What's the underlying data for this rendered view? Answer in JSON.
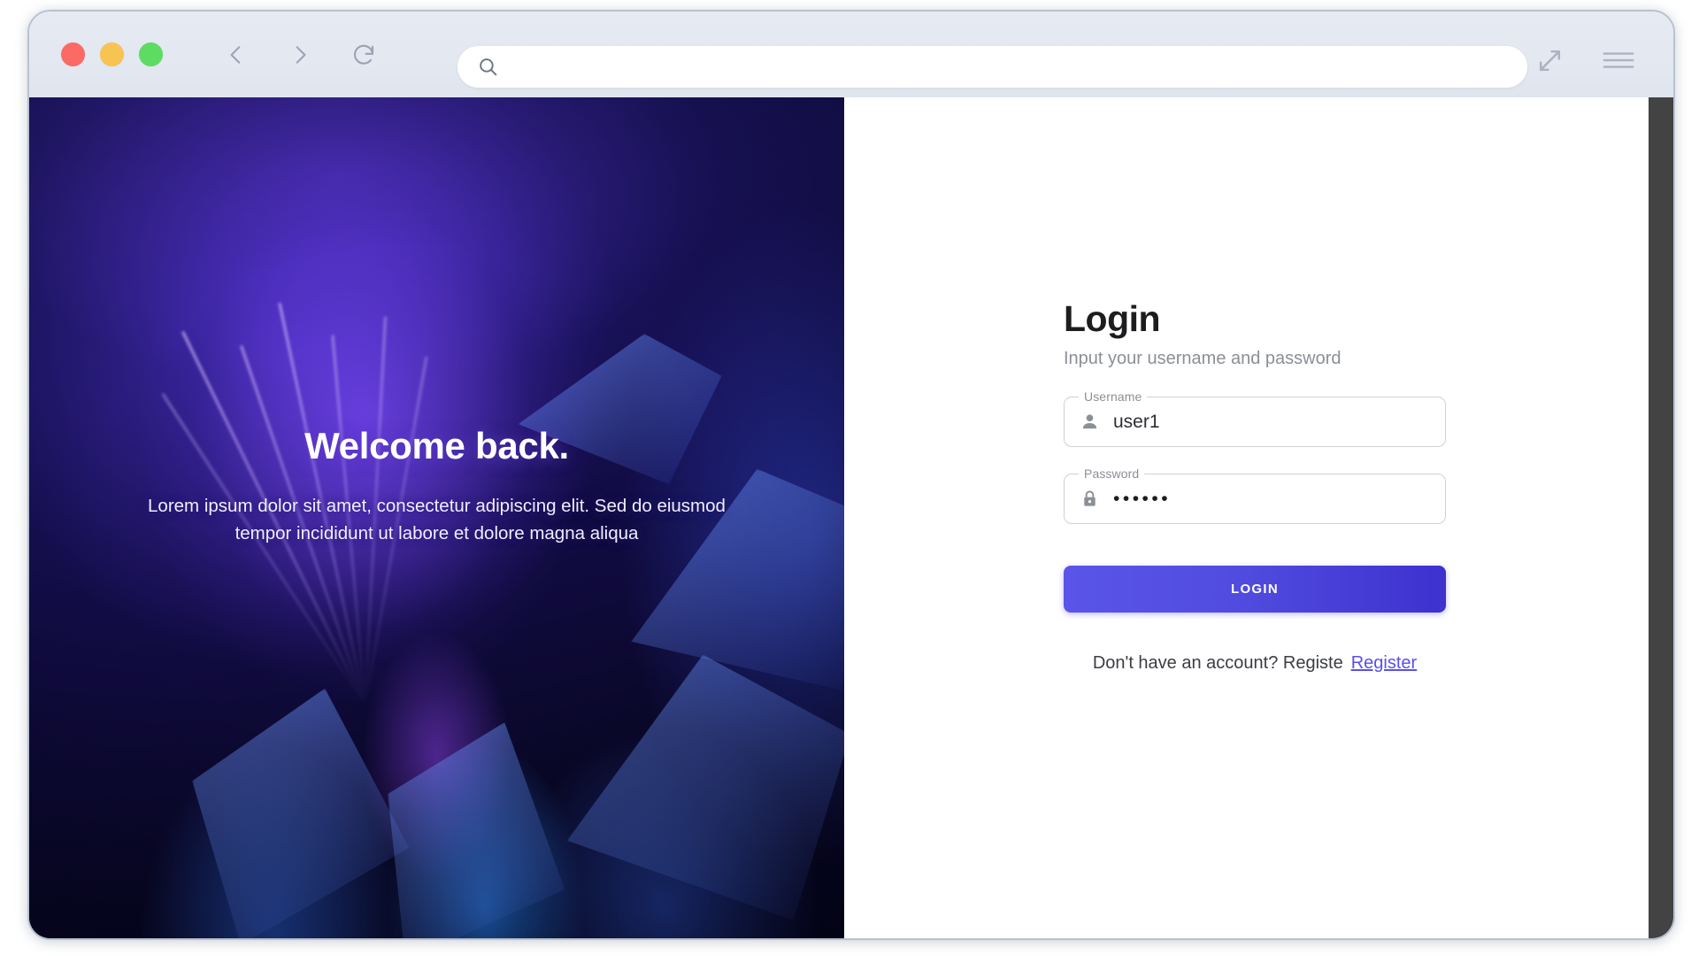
{
  "browser": {
    "traffic_lights": [
      {
        "name": "close",
        "color": "#fb6a64"
      },
      {
        "name": "minimize",
        "color": "#f7c452"
      },
      {
        "name": "maximize",
        "color": "#5ddb62"
      }
    ],
    "back_icon": "chevron-left-icon",
    "forward_icon": "chevron-right-icon",
    "reload_icon": "reload-icon",
    "search_icon": "search-icon",
    "expand_icon": "expand-arrows-icon",
    "menu_icon": "hamburger-menu-icon",
    "url": {
      "value": "",
      "placeholder": ""
    }
  },
  "hero": {
    "title": "Welcome back.",
    "subtitle": "Lorem ipsum dolor sit amet, consectetur adipiscing elit. Sed do eiusmod tempor incididunt ut labore et dolore magna aliqua"
  },
  "login": {
    "title": "Login",
    "subtitle": "Input your username and password",
    "username": {
      "label": "Username",
      "value": "user1",
      "placeholder": "",
      "icon": "person-icon"
    },
    "password": {
      "label": "Password",
      "value": "••••••",
      "placeholder": "",
      "icon": "lock-icon"
    },
    "submit_label": "LOGIN",
    "register_prompt": "Don't have an account? Registe",
    "register_link_label": "Register"
  },
  "colors": {
    "accent": "#5b50e8",
    "button_gradient_start": "#5a55e8",
    "button_gradient_end": "#3d31cf",
    "toolbar_bg": "#e3e8f1",
    "hero_dark": "#0b0a2e",
    "scrollbar": "#434343"
  }
}
